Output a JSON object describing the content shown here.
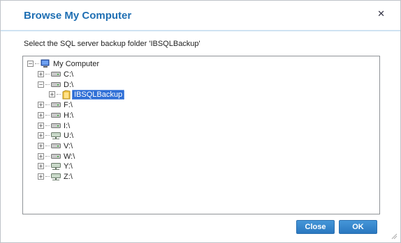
{
  "dialog": {
    "title": "Browse My Computer",
    "prompt": "Select the SQL server backup folder 'IBSQLBackup'"
  },
  "tree": {
    "root": "My Computer",
    "drives": [
      "C:\\",
      "D:\\",
      "F:\\",
      "H:\\",
      "I:\\",
      "U:\\",
      "V:\\",
      "W:\\",
      "Y:\\",
      "Z:\\"
    ],
    "selected_folder": "IBSQLBackup"
  },
  "buttons": {
    "close": "Close",
    "ok": "OK"
  },
  "colors": {
    "accent": "#1f6fb3",
    "button": "#2f7fc6",
    "selection": "#2f6fd6"
  }
}
